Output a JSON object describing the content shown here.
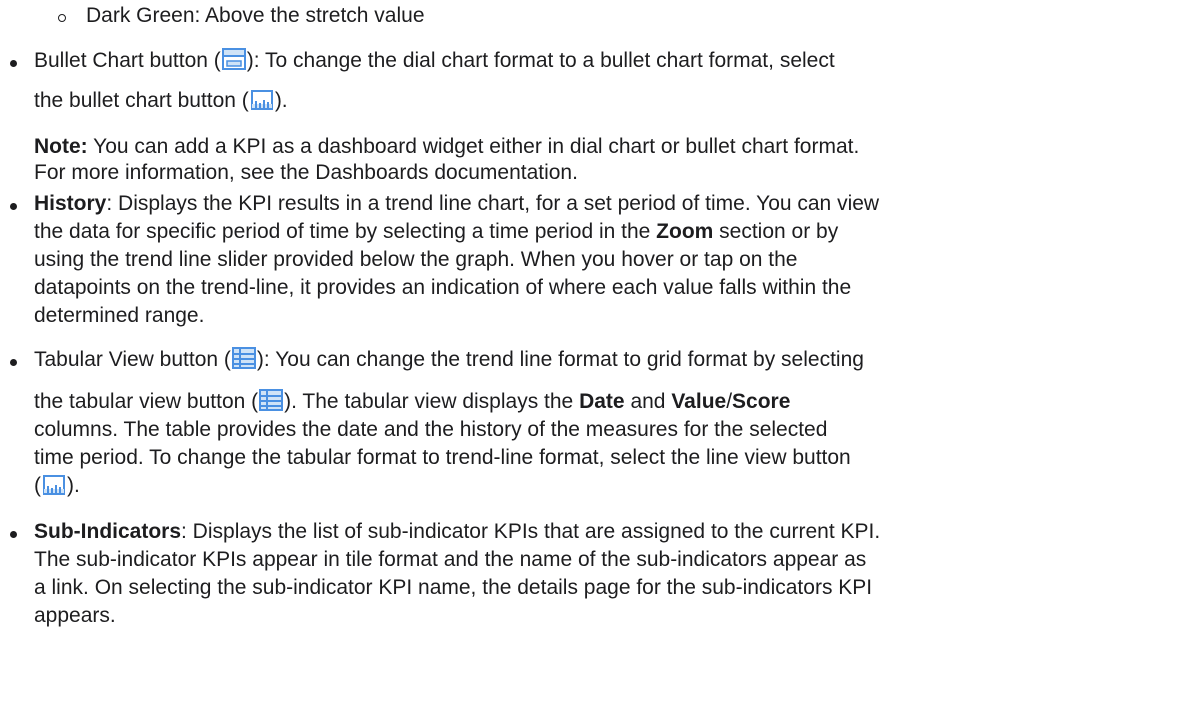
{
  "colors": {
    "text": "#1d1d1f",
    "icon_blue": "#4a90e2",
    "icon_fill": "#cfe3f7"
  },
  "icons": {
    "bullet_chart_button": "bullet-chart-icon",
    "line_view_button": "line-view-icon",
    "tabular_view_button": "tabular-view-icon"
  },
  "top_item": {
    "text": "Dark Green: Above the stretch value"
  },
  "bullet_chart": {
    "l1_a": "Bullet Chart button (",
    "l1_b": "): To change the dial chart format to a bullet chart format, select",
    "l2_a": "the bullet chart button (",
    "l2_b": ")."
  },
  "note": {
    "label": "Note:",
    "l1": " You can add a KPI as a dashboard widget either in dial chart or bullet chart format.",
    "l2": "For more information, see the Dashboards documentation."
  },
  "history": {
    "label": "History",
    "l1": ": Displays the KPI results in a trend line chart, for a set period of time. You can view",
    "l2_a": "the data for specific period of time by selecting a time period in the ",
    "l2_bold": "Zoom",
    "l2_b": " section or by",
    "l3": "using the trend line slider provided below the graph. When you hover or tap on the",
    "l4": "datapoints on the trend-line, it provides an indication of where each value falls within the",
    "l5": "determined range."
  },
  "tabular": {
    "l1_a": "Tabular View button (",
    "l1_b": "): You can change the trend line format to grid format by selecting",
    "l2_a": "the tabular view button (",
    "l2_b": "). The tabular view displays the ",
    "l2_bold1": "Date",
    "l2_c": " and ",
    "l2_bold2": "Value",
    "l2_d": "/",
    "l2_bold3": "Score",
    "l3": "columns. The table provides the date and the history of the measures for the selected",
    "l4": "time period. To change the tabular format to trend-line format, select the line view button",
    "l5_a": "(",
    "l5_b": ")."
  },
  "sub_indicators": {
    "label": "Sub-Indicators",
    "l1": ": Displays the list of sub-indicator KPIs that are assigned to the current KPI.",
    "l2": "The sub-indicator KPIs appear in tile format and the name of the sub-indicators appear as",
    "l3": "a link. On selecting the sub-indicator KPI name, the details page for the sub-indicators KPI",
    "l4": "appears."
  }
}
